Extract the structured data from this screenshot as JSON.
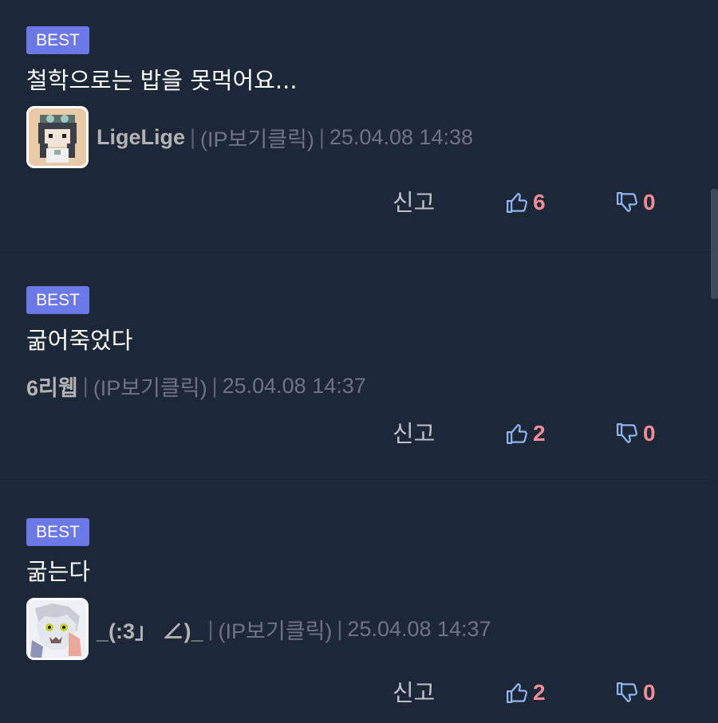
{
  "comments": [
    {
      "badge": "BEST",
      "text": "철학으로는 밥을 못먹어요...",
      "author": "LigeLige",
      "ip": "(IP보기클릭)",
      "timestamp": "25.04.08 14:38",
      "report_label": "신고",
      "upvotes": "6",
      "downvotes": "0",
      "has_avatar": true
    },
    {
      "badge": "BEST",
      "text": "굶어죽었다",
      "author": "6리웹",
      "ip": "(IP보기클릭)",
      "timestamp": "25.04.08 14:37",
      "report_label": "신고",
      "upvotes": "2",
      "downvotes": "0",
      "has_avatar": false
    },
    {
      "badge": "BEST",
      "text": "굶는다",
      "author": "_(:3」 ∠)_",
      "ip": "(IP보기클릭)",
      "timestamp": "25.04.08 14:37",
      "report_label": "신고",
      "upvotes": "2",
      "downvotes": "0",
      "has_avatar": true
    }
  ],
  "separator": "|",
  "icons": {
    "upvote": "thumbs-up-icon",
    "downvote": "thumbs-down-icon"
  },
  "colors": {
    "background": "#1c2738",
    "badge": "#6b78e6",
    "vote_count": "#f28b96",
    "vote_icon": "#8fb4f0"
  }
}
